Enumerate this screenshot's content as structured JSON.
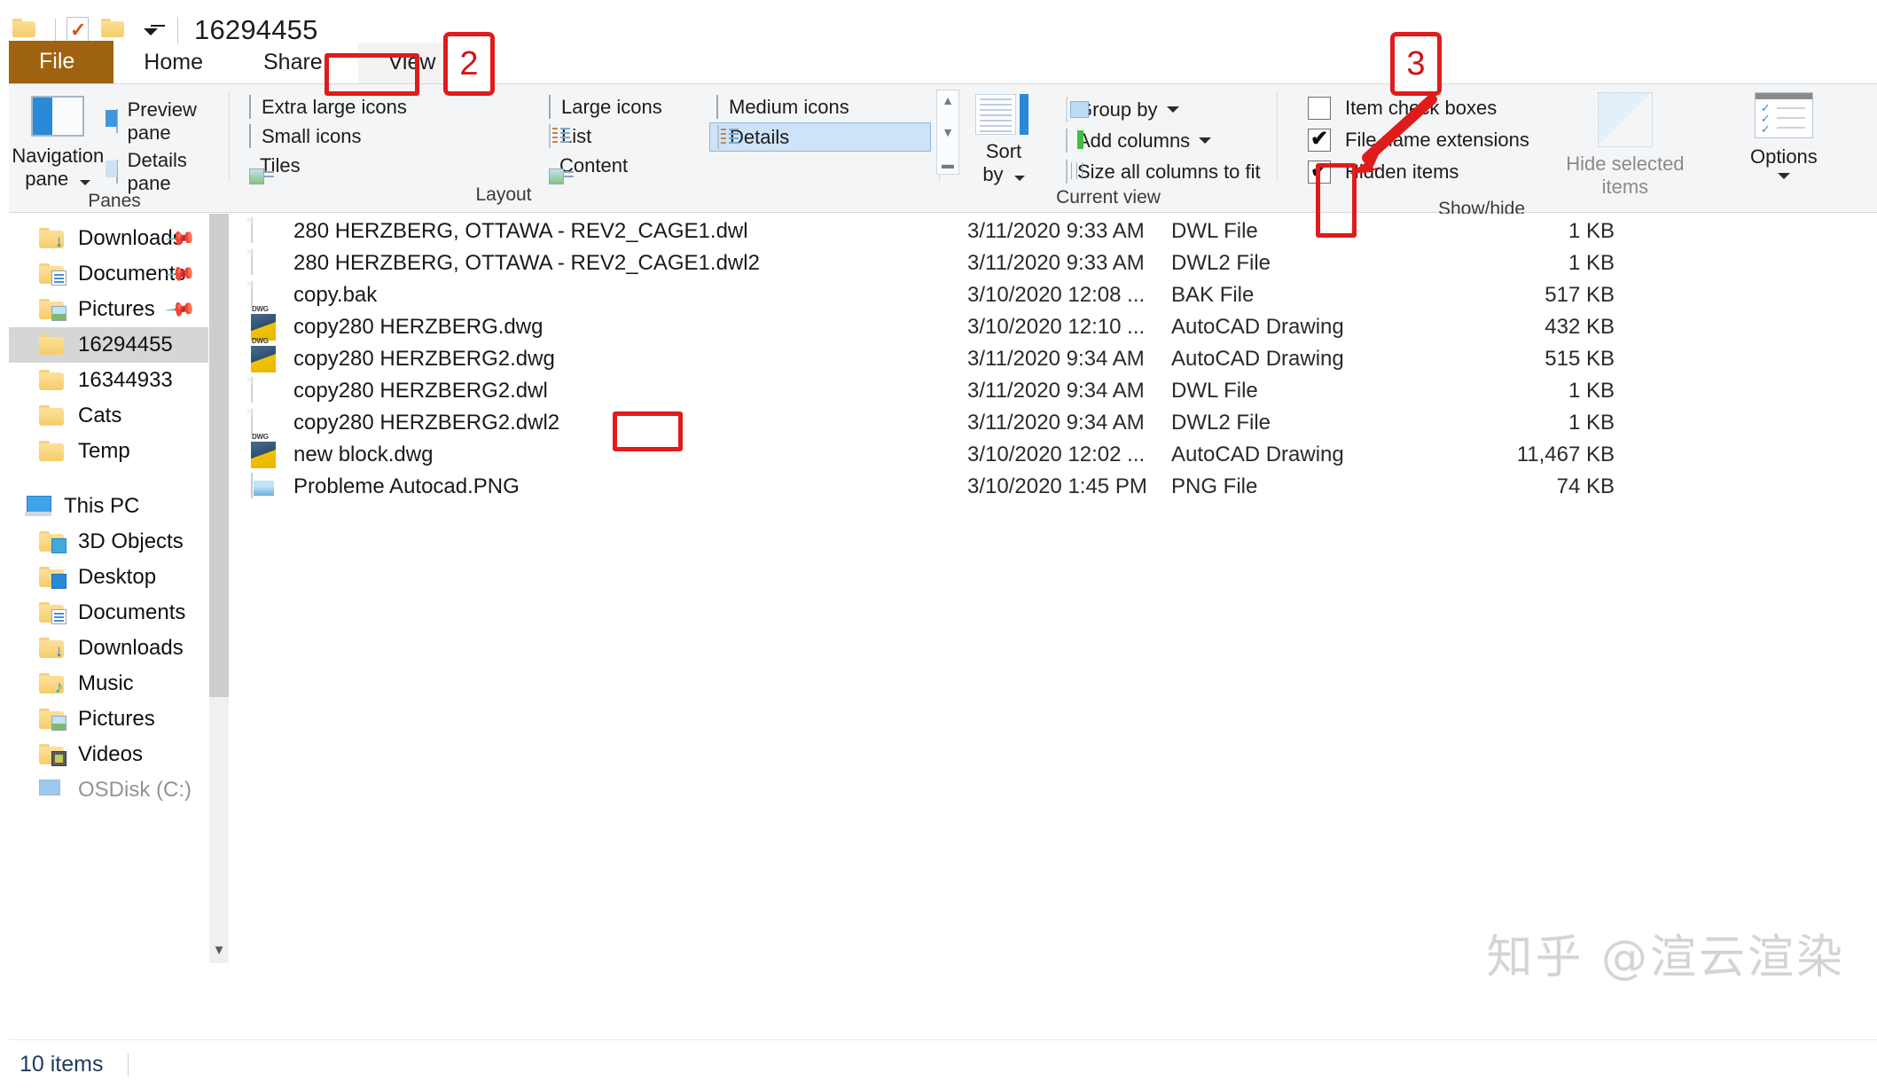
{
  "window": {
    "title": "16294455",
    "quick_access": [
      "folder-icon",
      "properties-icon",
      "new-folder-icon",
      "customize-caret"
    ]
  },
  "tabs": [
    {
      "id": "file",
      "label": "File"
    },
    {
      "id": "home",
      "label": "Home"
    },
    {
      "id": "share",
      "label": "Share"
    },
    {
      "id": "view",
      "label": "View"
    }
  ],
  "ribbon": {
    "panes": {
      "group_label": "Panes",
      "navigation_pane": "Navigation\npane",
      "navigation_pane_line1": "Navigation",
      "navigation_pane_line2": "pane",
      "preview_pane": "Preview pane",
      "details_pane": "Details pane"
    },
    "layout": {
      "group_label": "Layout",
      "items": [
        {
          "label": "Extra large icons",
          "selected": false
        },
        {
          "label": "Large icons",
          "selected": false
        },
        {
          "label": "Small icons",
          "selected": false
        },
        {
          "label": "List",
          "selected": false
        },
        {
          "label": "Tiles",
          "selected": false
        },
        {
          "label": "Content",
          "selected": false
        },
        {
          "label": "Medium icons",
          "selected": false
        },
        {
          "label": "Details",
          "selected": true
        }
      ],
      "scroll_up": "▲",
      "scroll_down": "▼",
      "scroll_more": "▬"
    },
    "current_view": {
      "group_label": "Current view",
      "sort_by_line1": "Sort",
      "sort_by_line2": "by",
      "group_by": "Group by",
      "add_columns": "Add columns",
      "size_all_columns": "Size all columns to fit"
    },
    "show_hide": {
      "group_label": "Show/hide",
      "item_check_boxes": {
        "label": "Item check boxes",
        "checked": false
      },
      "file_name_extensions": {
        "label": "File name extensions",
        "checked": true
      },
      "hidden_items": {
        "label": "Hidden items",
        "checked": true
      },
      "hide_selected_line1": "Hide selected",
      "hide_selected_line2": "items",
      "options": "Options"
    }
  },
  "sidebar": {
    "quick_access": [
      {
        "label": "Downloads",
        "icon": "folder-download-icon",
        "pinned": true,
        "indent": 1,
        "selected": false
      },
      {
        "label": "Documents",
        "icon": "folder-documents-icon",
        "pinned": true,
        "indent": 1,
        "selected": false
      },
      {
        "label": "Pictures",
        "icon": "folder-pictures-icon",
        "pinned": true,
        "indent": 1,
        "selected": false
      },
      {
        "label": "16294455",
        "icon": "folder-icon",
        "pinned": false,
        "indent": 1,
        "selected": true
      },
      {
        "label": "16344933",
        "icon": "folder-icon",
        "pinned": false,
        "indent": 1,
        "selected": false
      },
      {
        "label": "Cats",
        "icon": "folder-icon",
        "pinned": false,
        "indent": 1,
        "selected": false
      },
      {
        "label": "Temp",
        "icon": "folder-icon",
        "pinned": false,
        "indent": 1,
        "selected": false
      }
    ],
    "this_pc": {
      "label": "This PC",
      "icon": "computer-icon"
    },
    "this_pc_children": [
      {
        "label": "3D Objects",
        "icon": "folder-3dobjects-icon"
      },
      {
        "label": "Desktop",
        "icon": "folder-desktop-icon"
      },
      {
        "label": "Documents",
        "icon": "folder-documents-icon"
      },
      {
        "label": "Downloads",
        "icon": "folder-download-icon"
      },
      {
        "label": "Music",
        "icon": "folder-music-icon"
      },
      {
        "label": "Pictures",
        "icon": "folder-pictures-icon"
      },
      {
        "label": "Videos",
        "icon": "folder-videos-icon"
      },
      {
        "label": "OSDisk (C:)",
        "icon": "drive-icon"
      }
    ]
  },
  "files": [
    {
      "name": "280 HERZBERG, OTTAWA - REV2_CAGE1.dwl",
      "date": "3/11/2020 9:33 AM",
      "type": "DWL File",
      "size": "1 KB",
      "icon": "blank-file-icon"
    },
    {
      "name": "280 HERZBERG, OTTAWA - REV2_CAGE1.dwl2",
      "date": "3/11/2020 9:33 AM",
      "type": "DWL2 File",
      "size": "1 KB",
      "icon": "blank-file-icon"
    },
    {
      "name": "copy.bak",
      "date": "3/10/2020 12:08 ...",
      "type": "BAK File",
      "size": "517 KB",
      "icon": "blank-file-icon"
    },
    {
      "name": "copy280 HERZBERG.dwg",
      "date": "3/10/2020 12:10 ...",
      "type": "AutoCAD Drawing",
      "size": "432 KB",
      "icon": "dwg-file-icon"
    },
    {
      "name": "copy280 HERZBERG2.dwg",
      "date": "3/11/2020 9:34 AM",
      "type": "AutoCAD Drawing",
      "size": "515 KB",
      "icon": "dwg-file-icon"
    },
    {
      "name": "copy280 HERZBERG2.dwl",
      "date": "3/11/2020 9:34 AM",
      "type": "DWL File",
      "size": "1 KB",
      "icon": "blank-file-icon"
    },
    {
      "name": "copy280 HERZBERG2.dwl2",
      "date": "3/11/2020 9:34 AM",
      "type": "DWL2 File",
      "size": "1 KB",
      "icon": "blank-file-icon"
    },
    {
      "name": "new block.dwg",
      "date": "3/10/2020 12:02 ...",
      "type": "AutoCAD Drawing",
      "size": "11,467 KB",
      "icon": "dwg-file-icon"
    },
    {
      "name": "Probleme Autocad.PNG",
      "date": "3/10/2020 1:45 PM",
      "type": "PNG File",
      "size": "74 KB",
      "icon": "png-file-icon"
    }
  ],
  "status": {
    "item_count": "10 items"
  },
  "annotations": [
    {
      "id": "step-2",
      "label": "2"
    },
    {
      "id": "step-3",
      "label": "3"
    }
  ],
  "watermark": "知乎 @渲云渲染",
  "colors": {
    "file_tab": "#9e6211",
    "annotation_red": "#e01b1b",
    "selection_blue": "#cde3f7",
    "nav_selection": "#d6d6d6"
  }
}
